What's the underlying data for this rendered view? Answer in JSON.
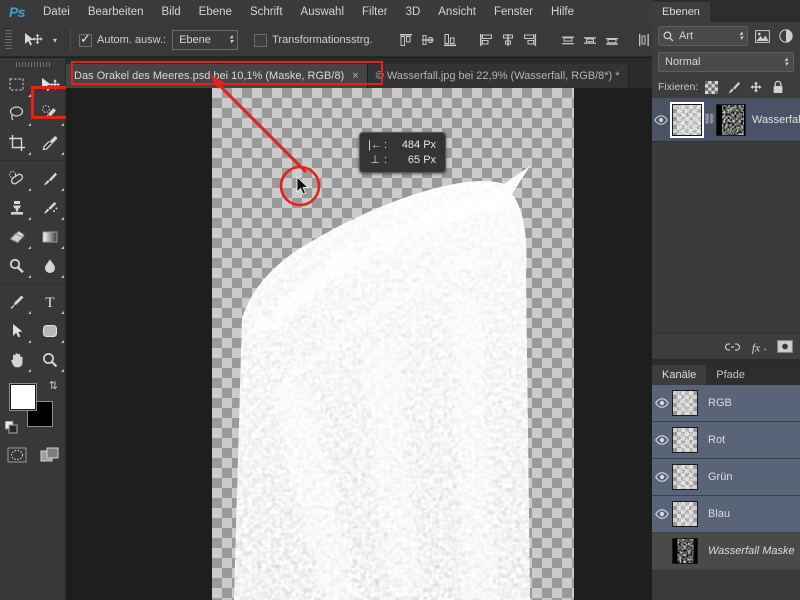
{
  "app": {
    "name": "Ps",
    "logo_color": "#3a9fd8"
  },
  "menubar": {
    "items": [
      "Datei",
      "Bearbeiten",
      "Bild",
      "Ebene",
      "Schrift",
      "Auswahl",
      "Filter",
      "3D",
      "Ansicht",
      "Fenster",
      "Hilfe"
    ]
  },
  "options_bar": {
    "tool_icon": "move-tool-icon",
    "auto_select_label": "Autom. ausw.:",
    "auto_select_checked": true,
    "auto_select_value": "Ebene",
    "transform_controls_label": "Transformationsstrg.",
    "transform_controls_checked": false,
    "align_icons": [
      "align-top-edges-icon",
      "align-vertical-centers-icon",
      "align-bottom-edges-icon",
      "align-left-edges-icon",
      "align-horizontal-centers-icon",
      "align-right-edges-icon",
      "distribute-top-icon",
      "distribute-vertical-center-icon",
      "distribute-bottom-icon",
      "distribute-left-icon"
    ]
  },
  "toolbar": {
    "highlighted_tool": "move-tool",
    "tools": [
      "rectangular-marquee-icon",
      "move-tool-icon",
      "lasso-icon",
      "quick-selection-icon",
      "crop-icon",
      "eyedropper-icon",
      "spot-healing-icon",
      "brush-icon",
      "clone-stamp-icon",
      "history-brush-icon",
      "eraser-icon",
      "gradient-icon",
      "dodge-icon",
      "blur-icon",
      "pen-icon",
      "type-icon",
      "path-selection-icon",
      "shape-icon",
      "hand-icon",
      "zoom-icon"
    ],
    "foreground_color": "#ffffff",
    "background_color": "#000000",
    "swap_icon": "swap-colors-icon",
    "default_colors_icon": "default-colors-icon",
    "quick_mask_icon": "quick-mask-icon",
    "screen_mode_icon": "screen-mode-icon"
  },
  "document_tabs": [
    {
      "title": "Das Orakel des Meeres.psd bei 10,1% (Maske, RGB/8)",
      "active": true,
      "close_label": "×",
      "highlighted": true
    },
    {
      "title": "© Wasserfall.jpg bei 22,9% (Wasserfall, RGB/8*) *",
      "active": false,
      "close_label": ""
    }
  ],
  "canvas": {
    "measure_tooltip": {
      "horizontal_icon": "|←",
      "horizontal_value": "484 Px",
      "vertical_icon": "⊥",
      "vertical_value": "65 Px"
    },
    "annotation_color": "#e8201a",
    "cursor_icon": "arrow-cursor-icon"
  },
  "layers_panel": {
    "tabs": [
      {
        "label": "Ebenen",
        "active": true
      }
    ],
    "filter_placeholder": "Art",
    "filter_icon": "search-icon",
    "filter_extra_icons": [
      "image-filter-icon",
      "adjustment-filter-icon"
    ],
    "blend_mode": "Normal",
    "lock_label": "Fixieren:",
    "lock_icons": [
      "lock-transparency-icon",
      "lock-pixels-icon",
      "lock-position-icon",
      "lock-all-icon"
    ],
    "layers": [
      {
        "name": "Wasserfall",
        "visible": true,
        "has_mask": true,
        "linked": true,
        "selected": true
      }
    ],
    "footer_icons": [
      "link-layers-icon",
      "fx-icon",
      "add-mask-icon"
    ]
  },
  "channels_panel": {
    "tabs": [
      {
        "label": "Kanäle",
        "active": true
      },
      {
        "label": "Pfade",
        "active": false
      }
    ],
    "channels": [
      {
        "name": "RGB",
        "visible": true,
        "selected": true,
        "italic": false
      },
      {
        "name": "Rot",
        "visible": true,
        "selected": true,
        "italic": false
      },
      {
        "name": "Grün",
        "visible": true,
        "selected": true,
        "italic": false
      },
      {
        "name": "Blau",
        "visible": true,
        "selected": true,
        "italic": false
      },
      {
        "name": "Wasserfall Maske",
        "visible": false,
        "selected": false,
        "italic": true
      }
    ]
  },
  "colors": {
    "panel_bg": "#393939",
    "menu_bg": "#3b3b3b",
    "canvas_bg": "#1e1e1e",
    "accent_red": "#e8201a",
    "layer_selected": "#4a5366",
    "channel_selected": "#5a6478"
  }
}
